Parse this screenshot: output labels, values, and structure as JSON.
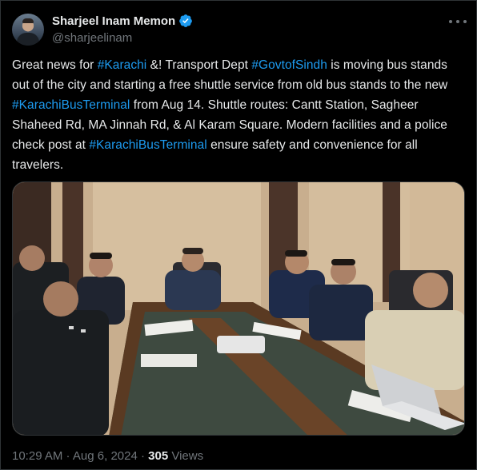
{
  "author": {
    "display_name": "Sharjeel Inam Memon",
    "handle": "@sharjeelinam",
    "verified": true,
    "avatar_icon": "profile-photo"
  },
  "tweet": {
    "segments": [
      {
        "text": "Great news for ",
        "tag": false
      },
      {
        "text": "#Karachi",
        "tag": true
      },
      {
        "text": " &! Transport Dept ",
        "tag": false
      },
      {
        "text": "#GovtofSindh",
        "tag": true
      },
      {
        "text": " is moving bus stands out of the city and starting a free shuttle service from old bus stands to the new ",
        "tag": false
      },
      {
        "text": "#KarachiBusTerminal",
        "tag": true
      },
      {
        "text": " from Aug 14. Shuttle routes: Cantt Station, Sagheer Shaheed Rd, MA Jinnah Rd, & Al Karam Square. Modern facilities and a police check post at ",
        "tag": false
      },
      {
        "text": "#KarachiBusTerminal",
        "tag": true
      },
      {
        "text": " ensure safety and convenience for all travelers.",
        "tag": false
      }
    ]
  },
  "meta": {
    "time": "10:29 AM",
    "separator": " · ",
    "date": "Aug 6, 2024",
    "views_count": "305",
    "views_label": " Views"
  },
  "colors": {
    "background": "#000000",
    "text": "#e7e9ea",
    "muted": "#71767b",
    "link": "#1d9bf0",
    "border": "#2f3336"
  }
}
